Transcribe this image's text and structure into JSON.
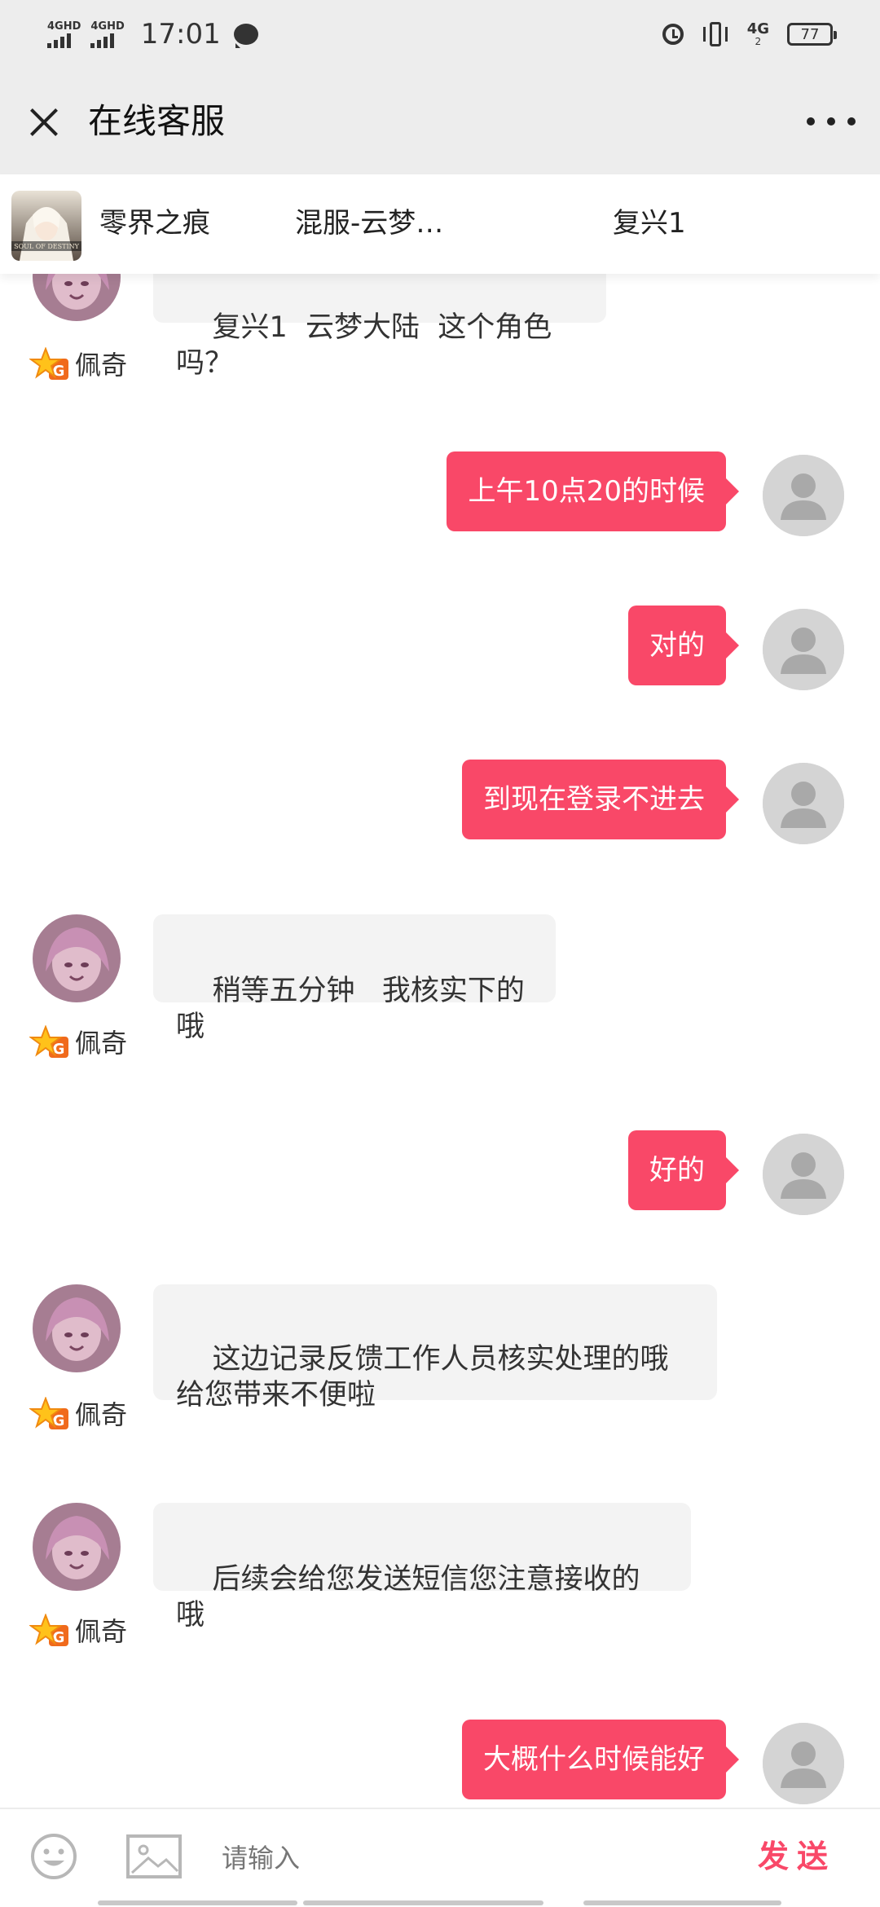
{
  "status_bar": {
    "network_1": "4GHD",
    "network_2": "4GHD",
    "time": "17:01",
    "network_3": "4G",
    "network_3_sub": "2",
    "battery": "77"
  },
  "header": {
    "title": "在线客服"
  },
  "game_info": {
    "game_name": "零界之痕",
    "server": "混服-云梦…",
    "character": "复兴1"
  },
  "messages": [
    {
      "from": "agent",
      "text": "复兴1  云梦大陆  这个角色吗？",
      "agent_name": "佩奇"
    },
    {
      "from": "user",
      "text": "上午10点20的时候"
    },
    {
      "from": "user",
      "text": "对的"
    },
    {
      "from": "user",
      "text": "到现在登录不进去"
    },
    {
      "from": "agent",
      "text": "稍等五分钟   我核实下的哦",
      "agent_name": "佩奇"
    },
    {
      "from": "user",
      "text": "好的"
    },
    {
      "from": "agent",
      "text": "这边记录反馈工作人员核实处理的哦\n给您带来不便啦",
      "agent_name": "佩奇"
    },
    {
      "from": "agent",
      "text": "后续会给您发送短信您注意接收的哦",
      "agent_name": "佩奇"
    },
    {
      "from": "user",
      "text": "大概什么时候能好"
    }
  ],
  "input": {
    "placeholder": "请输入",
    "value": "",
    "send_label": "发送"
  },
  "colors": {
    "accent": "#f94868",
    "bubble_in": "#f3f3f3",
    "header_bg": "#ededed"
  },
  "icons": {
    "close": "close-icon",
    "more": "more-icon",
    "emoji": "emoji-icon",
    "image": "image-icon",
    "agent_badge": "agent-badge-icon"
  }
}
